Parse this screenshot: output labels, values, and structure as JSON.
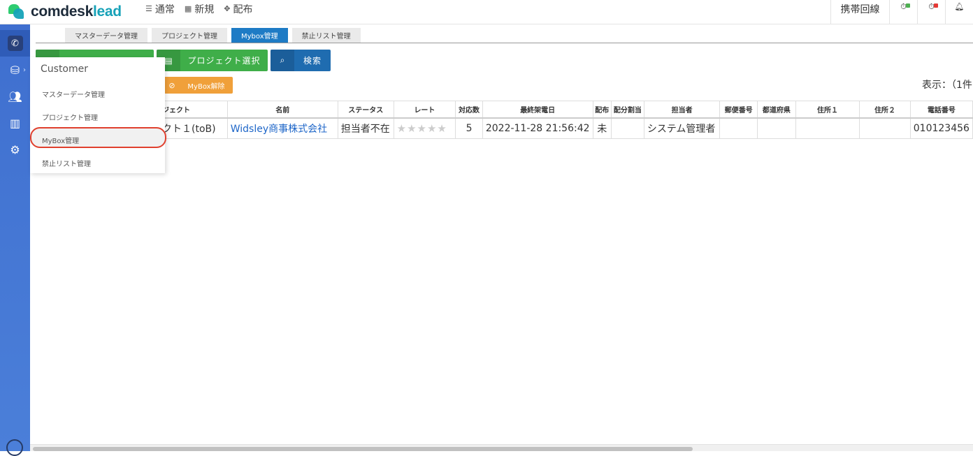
{
  "brand": {
    "name_a": "comdesk",
    "name_b": "lead"
  },
  "topnav": [
    {
      "icon": "list-icon",
      "label": "通常"
    },
    {
      "icon": "grid-icon",
      "label": "新規"
    },
    {
      "icon": "expand-icon",
      "label": "配布"
    }
  ],
  "topright": {
    "line": "携帯回線",
    "status_colors": [
      "#4caf50",
      "#e53935"
    ]
  },
  "tabs": [
    "マスターデータ管理",
    "プロジェクト管理",
    "Mybox管理",
    "禁止リスト管理"
  ],
  "active_tab": "Mybox管理",
  "buttons": {
    "project_select": "プロジェクト選択",
    "search": "検索",
    "mybox_release": "MyBox解除"
  },
  "display_count": "表示：（1件",
  "dropdown": {
    "title": "Customer",
    "items": [
      "マスターデータ管理",
      "プロジェクト管理",
      "MyBox管理",
      "禁止リスト管理"
    ],
    "selected": "MyBox管理"
  },
  "table": {
    "headers": [
      "ジェクト",
      "名前",
      "ステータス",
      "レート",
      "対応数",
      "最終架電日",
      "配布",
      "配分割当",
      "担当者",
      "郵便番号",
      "都道府県",
      "住所１",
      "住所２",
      "電話番号"
    ],
    "rows": [
      {
        "project": "クト１(toB)",
        "name": "Widsley商事株式会社",
        "status": "担当者不在",
        "rating": 0,
        "stars": "★★★★★",
        "count": "5",
        "last_call": "2022-11-28 21:56:42",
        "distribution": "未",
        "allocation": "",
        "owner": "システム管理者",
        "zip": "",
        "prefecture": "",
        "address1": "",
        "address2": "",
        "phone": "010123456"
      }
    ]
  },
  "colors": {
    "accent_blue": "#1e7bc5",
    "green": "#3fae49",
    "orange": "#f0a03a",
    "highlight": "#e0402e"
  }
}
